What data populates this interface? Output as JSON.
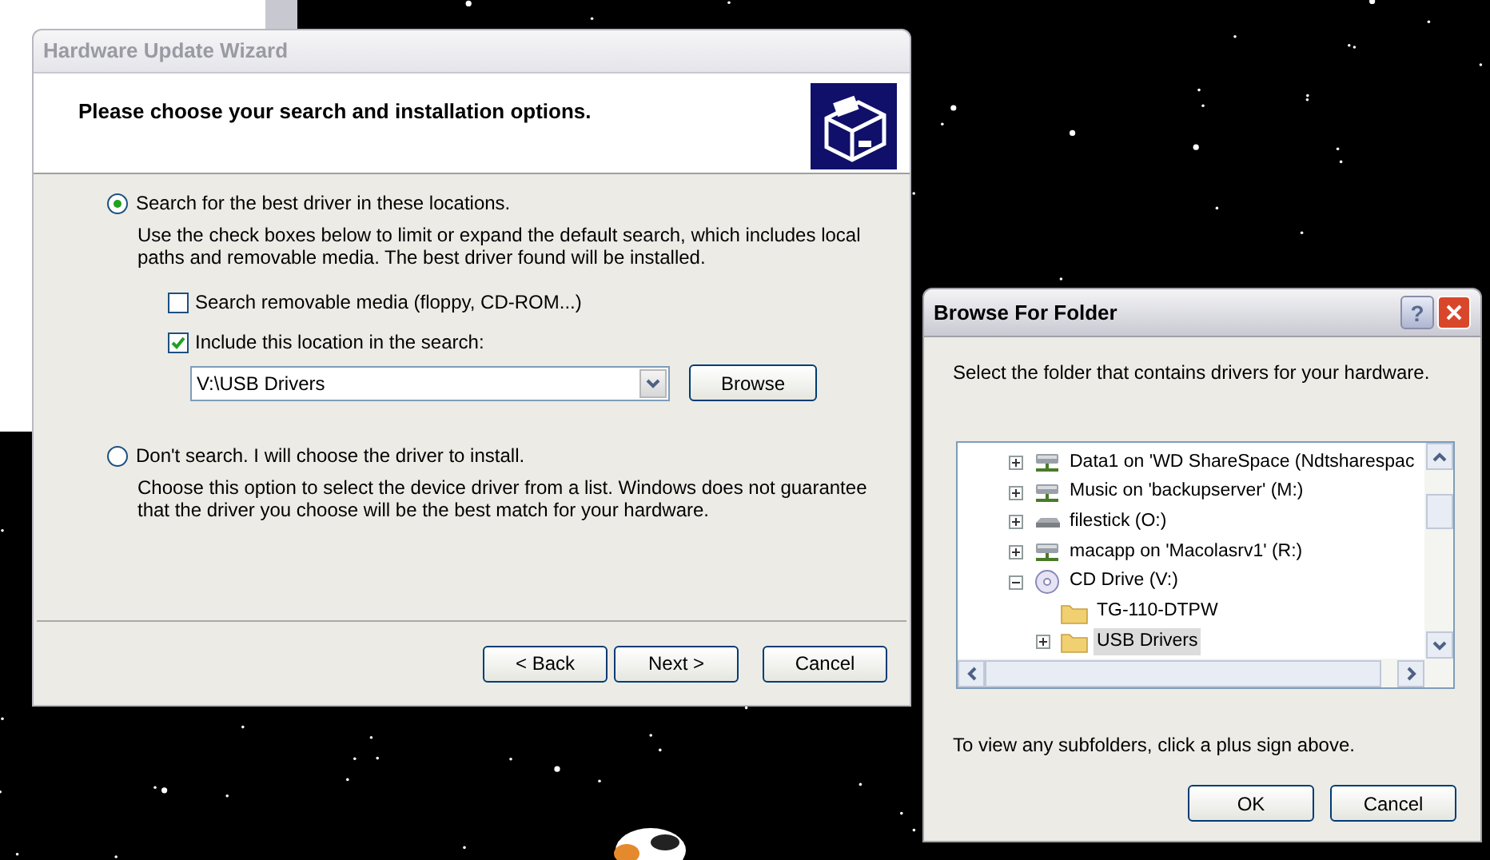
{
  "wizard": {
    "title": "Hardware Update Wizard",
    "active": false,
    "heading": "Please choose your search and installation options.",
    "options": [
      {
        "label": "Search for the best driver in these locations.",
        "selected": true,
        "description": "Use the check boxes below to limit or expand the default search, which includes local paths and removable media. The best driver found will be installed.",
        "checkboxes": [
          {
            "label": "Search removable media (floppy, CD-ROM...)",
            "checked": false
          },
          {
            "label": "Include this location in the search:",
            "checked": true
          }
        ],
        "location": {
          "value": "V:\\USB Drivers"
        },
        "browse_button": "Browse"
      },
      {
        "label": "Don't search. I will choose the driver to install.",
        "selected": false,
        "description": "Choose this option to select the device driver from a list.  Windows does not guarantee that the driver you choose will be the best match for your hardware."
      }
    ],
    "buttons": [
      "< Back",
      "Next >",
      "Cancel"
    ]
  },
  "browse_dialog": {
    "title": "Browse For Folder",
    "active": true,
    "help_button": "?",
    "prompt": "Select the folder that contains drivers for your hardware.",
    "tree": [
      {
        "label": "Data1 on 'WD ShareSpace (Ndtsharespac",
        "kind": "network",
        "expanded": false,
        "selected": false
      },
      {
        "label": "Music on 'backupserver' (M:)",
        "kind": "network",
        "expanded": false,
        "selected": false
      },
      {
        "label": "filestick (O:)",
        "kind": "drive",
        "expanded": false,
        "selected": false
      },
      {
        "label": "macapp on 'Macolasrv1' (R:)",
        "kind": "network",
        "expanded": false,
        "selected": false
      },
      {
        "label": "CD Drive (V:)",
        "kind": "cd",
        "expanded": true,
        "selected": false,
        "children": [
          {
            "label": "TG-110-DTPW",
            "kind": "folder",
            "selected": false
          },
          {
            "label": "USB Drivers",
            "kind": "folder",
            "expanded": false,
            "selected": true
          }
        ]
      }
    ],
    "hint": "To view any subfolders, click a plus sign above.",
    "buttons": [
      "OK",
      "Cancel"
    ]
  }
}
